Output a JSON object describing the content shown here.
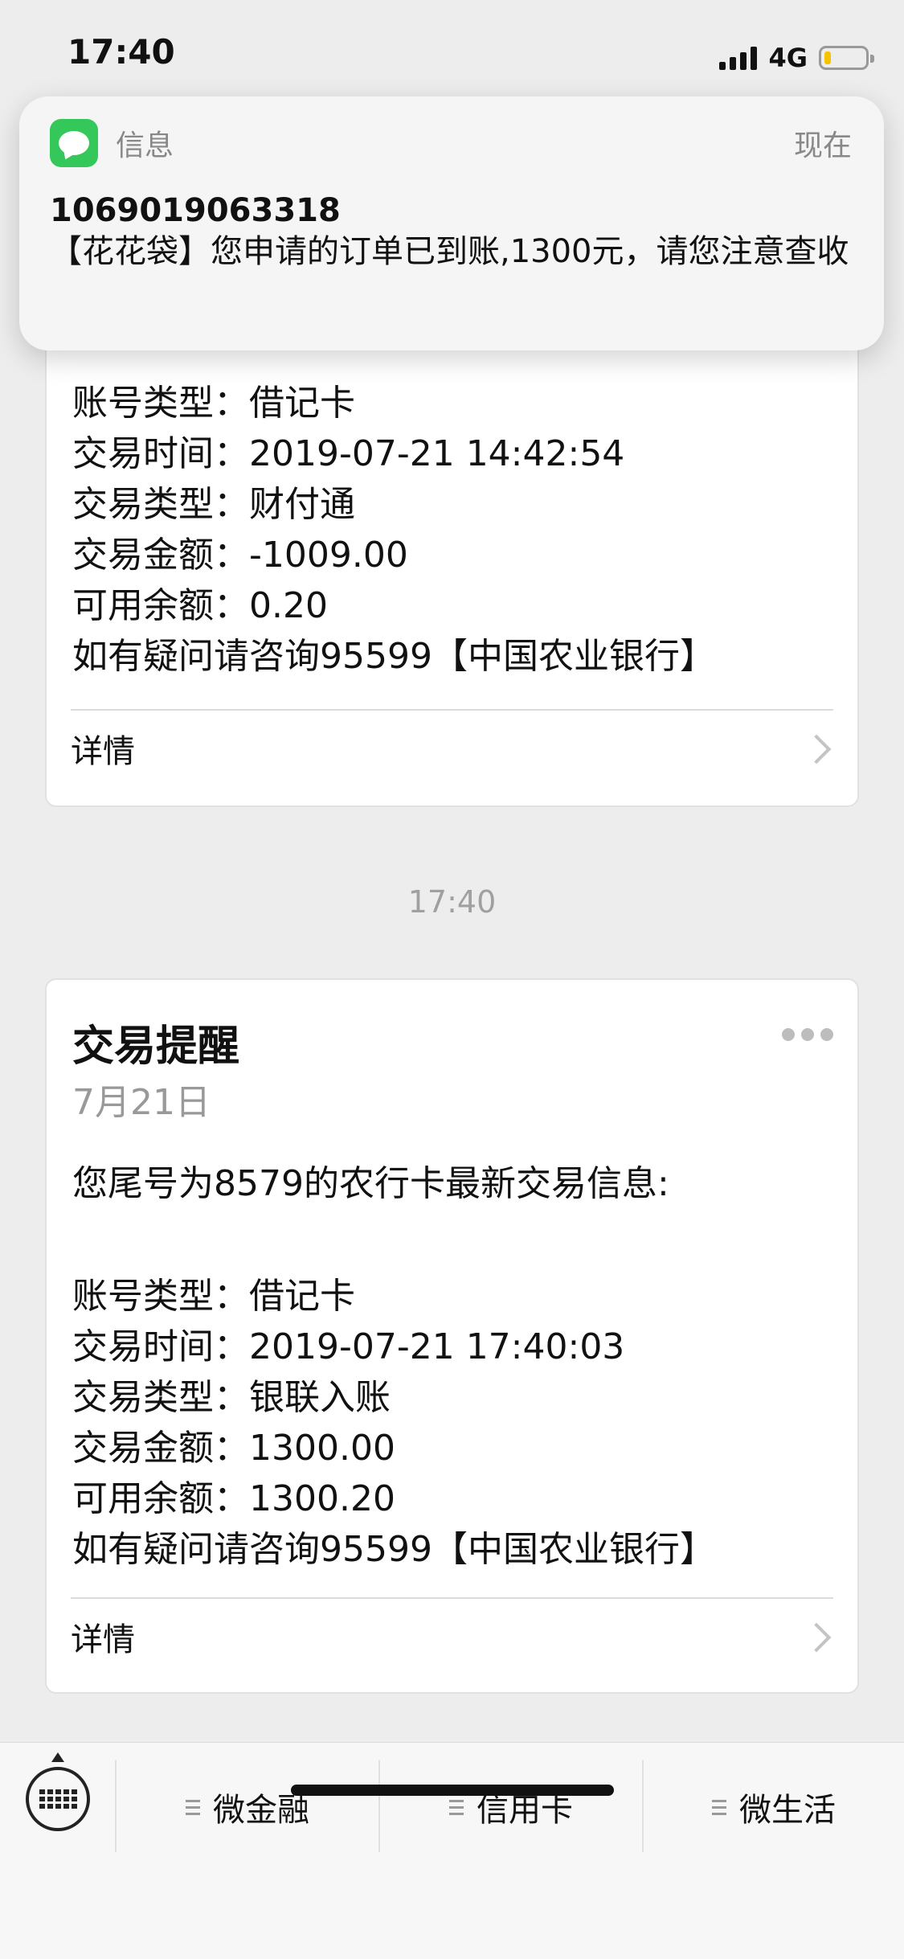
{
  "status_bar": {
    "time": "17:40",
    "network": "4G",
    "battery_level": 0.15,
    "battery_color": "#f5c400"
  },
  "notification": {
    "app_name": "信息",
    "time": "现在",
    "sender": "1069019063318",
    "body": "【花花袋】您申请的订单已到账,1300元，请您注意查收",
    "icon": "messages-icon",
    "icon_color": "#34c759"
  },
  "message1": {
    "lines": [
      "账号类型：借记卡",
      "交易时间：2019-07-21 14:42:54",
      "交易类型：财付通",
      "交易金额：-1009.00",
      "可用余额：0.20",
      "如有疑问请咨询95599【中国农业银行】"
    ],
    "detail_label": "详情"
  },
  "time_separator": "17:40",
  "message2": {
    "title": "交易提醒",
    "date": "7月21日",
    "intro": "您尾号为8579的农行卡最新交易信息:",
    "lines": [
      "账号类型：借记卡",
      "交易时间：2019-07-21 17:40:03",
      "交易类型：银联入账",
      "交易金额：1300.00",
      "可用余额：1300.20",
      "如有疑问请咨询95599【中国农业银行】"
    ],
    "detail_label": "详情"
  },
  "bottom_menu": {
    "items": [
      {
        "label": "微金融"
      },
      {
        "label": "信用卡"
      },
      {
        "label": "微生活"
      }
    ]
  }
}
